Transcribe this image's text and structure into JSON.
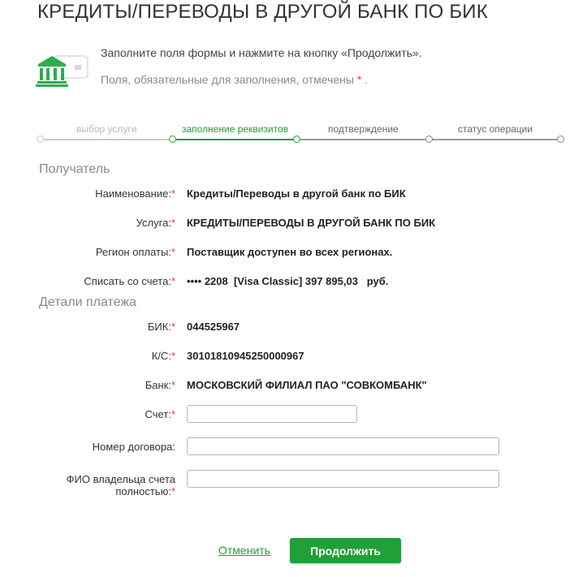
{
  "page": {
    "title": "КРЕДИТЫ/ПЕРЕВОДЫ В ДРУГОЙ БАНК ПО БИК"
  },
  "info": {
    "instruction": "Заполните поля формы и нажмите на кнопку «Продолжить».",
    "required_note": "Поля, обязательные для заполнения, отмечены",
    "required_mark": "*",
    "required_dot": "."
  },
  "steps": [
    {
      "label": "выбор услуги",
      "state": "done"
    },
    {
      "label": "заполнение реквизитов",
      "state": "active"
    },
    {
      "label": "подтверждение",
      "state": "todo"
    },
    {
      "label": "статус операции",
      "state": "todo"
    }
  ],
  "recipient": {
    "heading": "Получатель",
    "name_label": "Наименование:",
    "name_value": "Кредиты/Переводы в другой банк по БИК",
    "service_label": "Услуга:",
    "service_value": "КРЕДИТЫ/ПЕРЕВОДЫ В ДРУГОЙ БАНК ПО БИК",
    "region_label": "Регион оплаты:",
    "region_value": "Поставщик доступен во всех регионах.",
    "account_label": "Списать со счета:",
    "account_value": "•••• 2208  [Visa Classic] 397 895,03   руб."
  },
  "details": {
    "heading": "Детали платежа",
    "bik_label": "БИК:",
    "bik_value": "044525967",
    "ks_label": "К/С:",
    "ks_value": "30101810945250000967",
    "bank_label": "Банк:",
    "bank_value": "МОСКОВСКИЙ ФИЛИАЛ ПАО \"СОВКОМБАНК\"",
    "account_field_label": "Счет:",
    "account_field_value": "",
    "contract_label": "Номер договора:",
    "contract_value": "",
    "owner_label_line1": "ФИО владельца счета",
    "owner_label_line2": "полностью:",
    "owner_value": ""
  },
  "actions": {
    "cancel": "Отменить",
    "continue": "Продолжить"
  },
  "icons": {
    "bank": "bank-building-icon"
  },
  "colors": {
    "accent": "#21a038",
    "required": "#e63a3a",
    "muted": "#8a8a8a"
  }
}
